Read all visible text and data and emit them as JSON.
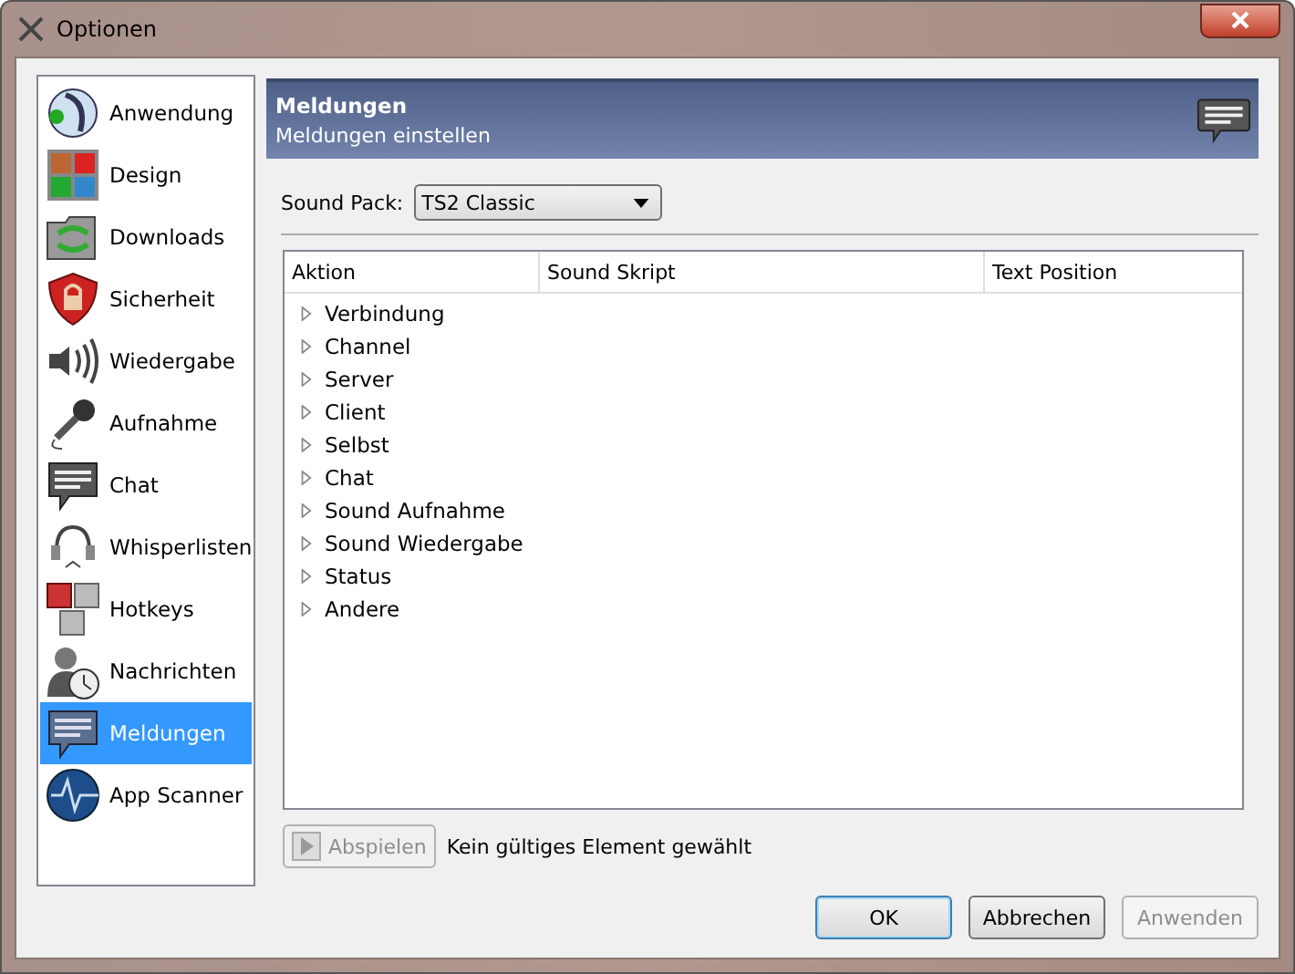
{
  "window": {
    "title": "Optionen"
  },
  "sidebar": {
    "items": [
      {
        "label": "Anwendung",
        "selected": false
      },
      {
        "label": "Design",
        "selected": false
      },
      {
        "label": "Downloads",
        "selected": false
      },
      {
        "label": "Sicherheit",
        "selected": false
      },
      {
        "label": "Wiedergabe",
        "selected": false
      },
      {
        "label": "Aufnahme",
        "selected": false
      },
      {
        "label": "Chat",
        "selected": false
      },
      {
        "label": "Whisperlisten",
        "selected": false
      },
      {
        "label": "Hotkeys",
        "selected": false
      },
      {
        "label": "Nachrichten",
        "selected": false
      },
      {
        "label": "Meldungen",
        "selected": true
      },
      {
        "label": "App Scanner",
        "selected": false
      }
    ]
  },
  "header": {
    "title": "Meldungen",
    "subtitle": "Meldungen einstellen"
  },
  "sound_pack": {
    "label": "Sound Pack:",
    "value": "TS2 Classic"
  },
  "table": {
    "columns": [
      "Aktion",
      "Sound Skript",
      "Text Position"
    ],
    "rows": [
      {
        "label": "Verbindung",
        "expanded": false
      },
      {
        "label": "Channel",
        "expanded": false
      },
      {
        "label": "Server",
        "expanded": false
      },
      {
        "label": "Client",
        "expanded": false
      },
      {
        "label": "Selbst",
        "expanded": false
      },
      {
        "label": "Chat",
        "expanded": false
      },
      {
        "label": "Sound Aufnahme",
        "expanded": false
      },
      {
        "label": "Sound Wiedergabe",
        "expanded": false
      },
      {
        "label": "Status",
        "expanded": false
      },
      {
        "label": "Andere",
        "expanded": false
      }
    ]
  },
  "play": {
    "label": "Abspielen",
    "disabled": true
  },
  "status": "Kein gültiges Element gewählt",
  "buttons": [
    {
      "label": "OK",
      "disabled": false,
      "default": true
    },
    {
      "label": "Abbrechen",
      "disabled": false,
      "default": false
    },
    {
      "label": "Anwenden",
      "disabled": true,
      "default": false
    }
  ]
}
